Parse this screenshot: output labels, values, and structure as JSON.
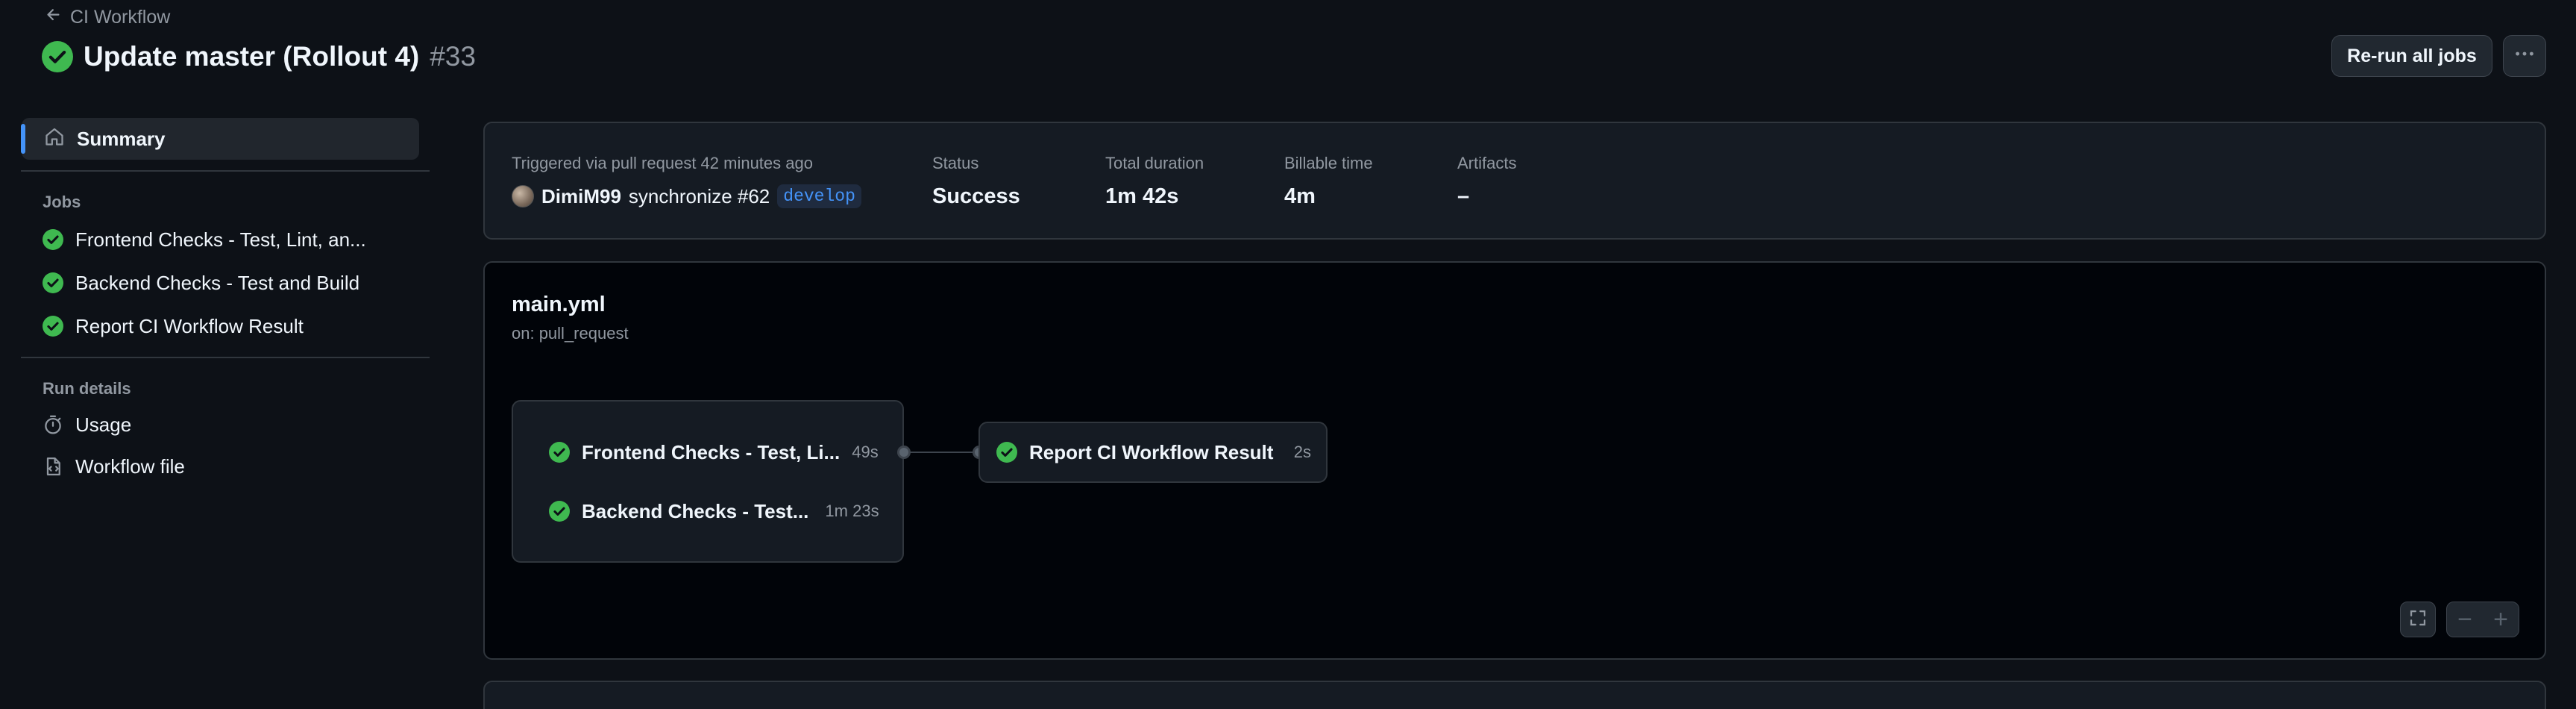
{
  "header": {
    "back_label": "CI Workflow",
    "title": "Update master (Rollout 4)",
    "run_number": "#33",
    "rerun_label": "Re-run all jobs"
  },
  "sidebar": {
    "summary_label": "Summary",
    "jobs_heading": "Jobs",
    "jobs": [
      {
        "label": "Frontend Checks - Test, Lint, an...",
        "status": "success"
      },
      {
        "label": "Backend Checks - Test and Build",
        "status": "success"
      },
      {
        "label": "Report CI Workflow Result",
        "status": "success"
      }
    ],
    "run_details_heading": "Run details",
    "usage_label": "Usage",
    "workflow_file_label": "Workflow file"
  },
  "summary": {
    "trigger_text": "Triggered via pull request 42 minutes ago",
    "user": "DimiM99",
    "action": "synchronize #62",
    "branch": "develop",
    "status_label": "Status",
    "status_value": "Success",
    "duration_label": "Total duration",
    "duration_value": "1m 42s",
    "billable_label": "Billable time",
    "billable_value": "4m",
    "artifacts_label": "Artifacts",
    "artifacts_value": "–"
  },
  "graph": {
    "workflow_name": "main.yml",
    "trigger": "on: pull_request",
    "group_jobs": [
      {
        "name": "Frontend Checks - Test, Li...",
        "duration": "49s"
      },
      {
        "name": "Backend Checks - Test...",
        "duration": "1m 23s"
      }
    ],
    "final_job": {
      "name": "Report CI Workflow Result",
      "duration": "2s"
    }
  },
  "colors": {
    "success": "#3fb950",
    "accent": "#4493f8",
    "background": "#0d1117"
  }
}
